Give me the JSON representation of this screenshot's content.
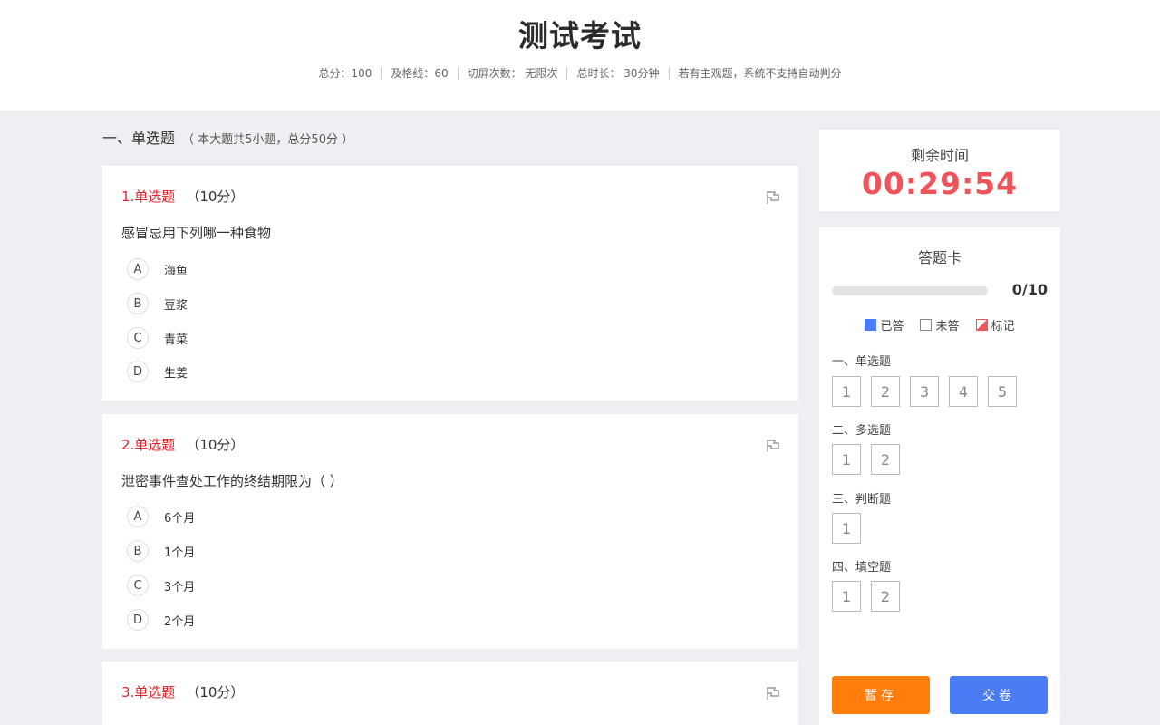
{
  "exam": {
    "title": "测试考试",
    "meta": [
      "总分：100",
      "及格线：60",
      "切屏次数： 无限次",
      "总时长： 30分钟",
      "若有主观题，系统不支持自动判分"
    ]
  },
  "section": {
    "title": "一、单选题",
    "subtitle": "（ 本大题共5小题，总分50分 ）"
  },
  "questions": [
    {
      "type": "1.单选题",
      "score": "（10分）",
      "text": "感冒忌用下列哪一种食物",
      "options": [
        {
          "letter": "A",
          "text": "海鱼"
        },
        {
          "letter": "B",
          "text": "豆浆"
        },
        {
          "letter": "C",
          "text": "青菜"
        },
        {
          "letter": "D",
          "text": "生姜"
        }
      ]
    },
    {
      "type": "2.单选题",
      "score": "（10分）",
      "text": "泄密事件查处工作的终结期限为（ ）",
      "options": [
        {
          "letter": "A",
          "text": "6个月"
        },
        {
          "letter": "B",
          "text": "1个月"
        },
        {
          "letter": "C",
          "text": "3个月"
        },
        {
          "letter": "D",
          "text": "2个月"
        }
      ]
    },
    {
      "type": "3.单选题",
      "score": "（10分）",
      "text": ""
    }
  ],
  "timer": {
    "label": "剩余时间",
    "value": "00:29:54"
  },
  "answer_card": {
    "title": "答题卡",
    "progress_text": "0/10",
    "progress_fraction": 0,
    "legend": [
      "已答",
      "未答",
      "标记"
    ],
    "groups": [
      {
        "label": "一、单选题",
        "numbers": [
          "1",
          "2",
          "3",
          "4",
          "5"
        ]
      },
      {
        "label": "二、多选题",
        "numbers": [
          "1",
          "2"
        ]
      },
      {
        "label": "三、判断题",
        "numbers": [
          "1"
        ]
      },
      {
        "label": "四、填空题",
        "numbers": [
          "1",
          "2"
        ]
      }
    ],
    "save_label": "暂存",
    "submit_label": "交卷"
  },
  "colors": {
    "accent_blue": "#4a7cf6",
    "accent_orange": "#ff7d0d",
    "timer_red": "#f0545b",
    "question_red": "#e0252b"
  }
}
